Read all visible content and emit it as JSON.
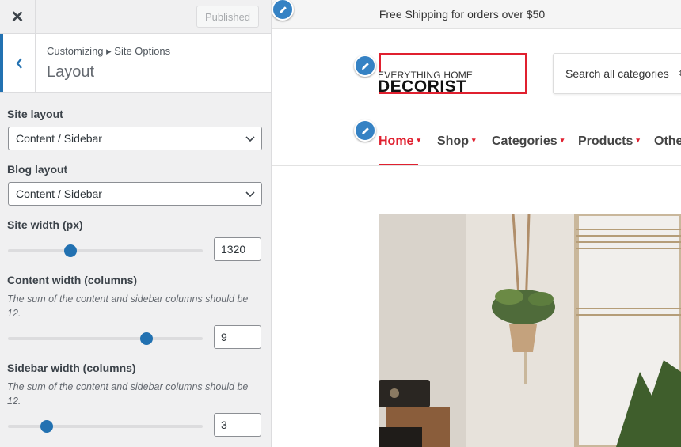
{
  "customizer": {
    "close_icon": "close-icon",
    "publish_label": "Published",
    "breadcrumb": "Customizing ▸ Site Options",
    "section_title": "Layout",
    "site_layout": {
      "label": "Site layout",
      "value": "Content / Sidebar"
    },
    "blog_layout": {
      "label": "Blog layout",
      "value": "Content / Sidebar"
    },
    "site_width": {
      "label": "Site width (px)",
      "value": "1320",
      "slider_fraction": 0.32
    },
    "content_width": {
      "label": "Content width (columns)",
      "description": "The sum of the content and sidebar columns should be 12.",
      "value": "9",
      "slider_fraction": 0.71
    },
    "sidebar_width": {
      "label": "Sidebar width (columns)",
      "description": "The sum of the content and sidebar columns should be 12.",
      "value": "3",
      "slider_fraction": 0.2
    }
  },
  "preview": {
    "promo_text": "Free Shipping for orders over $50",
    "logo": {
      "tagline": "EVERYTHING HOME",
      "name": "DECORIST"
    },
    "search_placeholder": "Search all categories",
    "nav": [
      {
        "label": "Home",
        "active": true
      },
      {
        "label": "Shop",
        "active": false
      },
      {
        "label": "Categories",
        "active": false
      },
      {
        "label": "Products",
        "active": false
      },
      {
        "label": "Othe",
        "active": false
      }
    ]
  },
  "colors": {
    "accent": "#2271b1",
    "brand_red": "#e0202f",
    "edit_pencil": "#3582c4"
  }
}
